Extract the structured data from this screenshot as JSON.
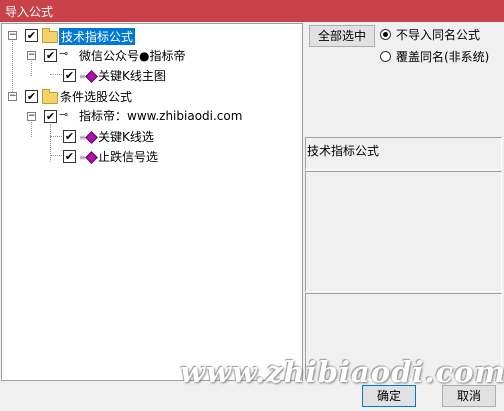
{
  "window": {
    "title": "导入公式"
  },
  "tree": {
    "root1": {
      "label": "技术指标公式",
      "checked": true
    },
    "group1": {
      "label": "微信公众号●指标帝",
      "checked": true
    },
    "item1": {
      "label": "关键K线主图",
      "checked": true
    },
    "root2": {
      "label": "条件选股公式",
      "checked": true
    },
    "group2": {
      "label": "指标帝：www.zhibiaodi.com",
      "checked": true
    },
    "item2": {
      "label": "关键K线选",
      "checked": true
    },
    "item3": {
      "label": "止跌信号选",
      "checked": true
    }
  },
  "controls": {
    "select_all": "全部选中",
    "radio_skip": "不导入同名公式",
    "radio_overwrite": "覆盖同名(非系统)",
    "selected_radio": "radio_skip"
  },
  "details": {
    "formula_type": "技术指标公式"
  },
  "footer": {
    "ok": "确定",
    "cancel": "取消"
  },
  "watermark": "www.zhibiaodi.com",
  "icons": {
    "check": "✔",
    "expander": "−",
    "key": "⊸",
    "gem": "formula-gem-icon"
  },
  "colors": {
    "titlebar": "#c9424a",
    "selection": "#0078d7"
  }
}
